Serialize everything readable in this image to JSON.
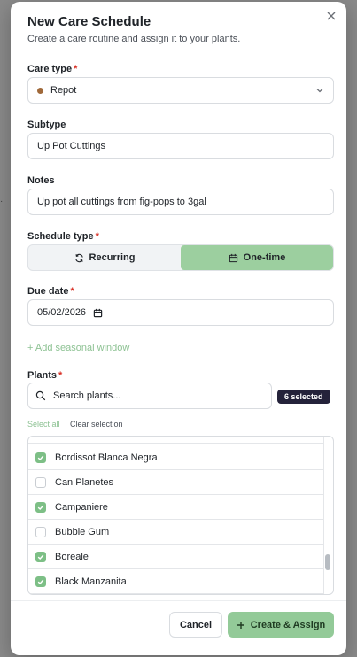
{
  "modal": {
    "title": "New Care Schedule",
    "subtitle": "Create a care routine and assign it to your plants.",
    "close_icon": "x-icon"
  },
  "care_type": {
    "label": "Care type",
    "required": "*",
    "value": "Repot",
    "dot_color": "#a0693a",
    "icon": "chevron-down-icon"
  },
  "subtype": {
    "label": "Subtype",
    "value": "Up Pot Cuttings"
  },
  "notes": {
    "label": "Notes",
    "value": "Up pot all cuttings from fig-pops to 3gal"
  },
  "schedule_type": {
    "label": "Schedule type",
    "required": "*",
    "options": [
      {
        "label": "Recurring",
        "icon": "refresh-icon",
        "active": false
      },
      {
        "label": "One-time",
        "icon": "calendar-icon",
        "active": true
      }
    ]
  },
  "due_date": {
    "label": "Due date",
    "required": "*",
    "value": "05/02/2026",
    "icon": "calendar-icon"
  },
  "seasonal": {
    "label": "+ Add seasonal window"
  },
  "plants": {
    "label": "Plants",
    "required": "*",
    "search_placeholder": "Search plants...",
    "selected_badge": "6 selected",
    "select_all": "Select all",
    "clear_selection": "Clear selection",
    "items": [
      {
        "name": "Bordissot Blanca Negra",
        "checked": true
      },
      {
        "name": "Can Planetes",
        "checked": false
      },
      {
        "name": "Campaniere",
        "checked": true
      },
      {
        "name": "Bubble Gum",
        "checked": false
      },
      {
        "name": "Boreale",
        "checked": true
      },
      {
        "name": "Black Manzanita",
        "checked": true
      }
    ]
  },
  "footer": {
    "cancel": "Cancel",
    "create": "Create & Assign"
  },
  "colors": {
    "accent": "#93ca98",
    "accent_text": "#8dc293",
    "badge": "#24223a",
    "required": "#d93025"
  }
}
